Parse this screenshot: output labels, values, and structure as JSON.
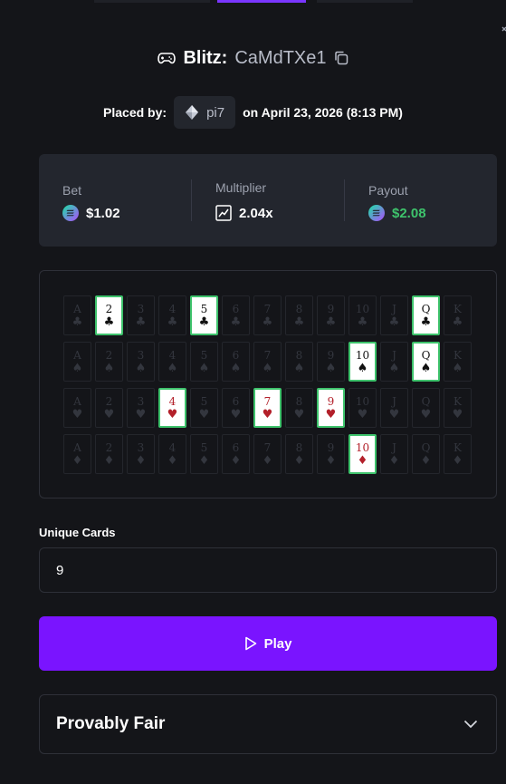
{
  "title": {
    "game": "Blitz:",
    "game_id": "CaMdTXe1"
  },
  "placed": {
    "prefix": "Placed by:",
    "username": "pi7",
    "suffix": "on April 23, 2026 (8:13 PM)"
  },
  "stats": {
    "bet": {
      "label": "Bet",
      "value": "$1.02"
    },
    "multiplier": {
      "label": "Multiplier",
      "value": "2.04x"
    },
    "payout": {
      "label": "Payout",
      "value": "$2.08",
      "color": "#3ec36c"
    }
  },
  "board": {
    "ranks": [
      "A",
      "2",
      "3",
      "4",
      "5",
      "6",
      "7",
      "8",
      "9",
      "10",
      "J",
      "Q",
      "K"
    ],
    "rows": [
      {
        "suit": "♣",
        "red": false,
        "selected": [
          "2",
          "5",
          "Q"
        ]
      },
      {
        "suit": "♠",
        "red": false,
        "selected": [
          "10",
          "Q"
        ]
      },
      {
        "suit": "♥",
        "red": true,
        "selected": [
          "4",
          "7",
          "9"
        ]
      },
      {
        "suit": "♦",
        "red": true,
        "selected": [
          "10"
        ]
      }
    ],
    "selected_color": "#3ec36c"
  },
  "unique_cards": {
    "label": "Unique Cards",
    "value": "9"
  },
  "play_button": {
    "label": "Play",
    "color": "#7a14ff"
  },
  "provably_fair": {
    "label": "Provably Fair"
  }
}
